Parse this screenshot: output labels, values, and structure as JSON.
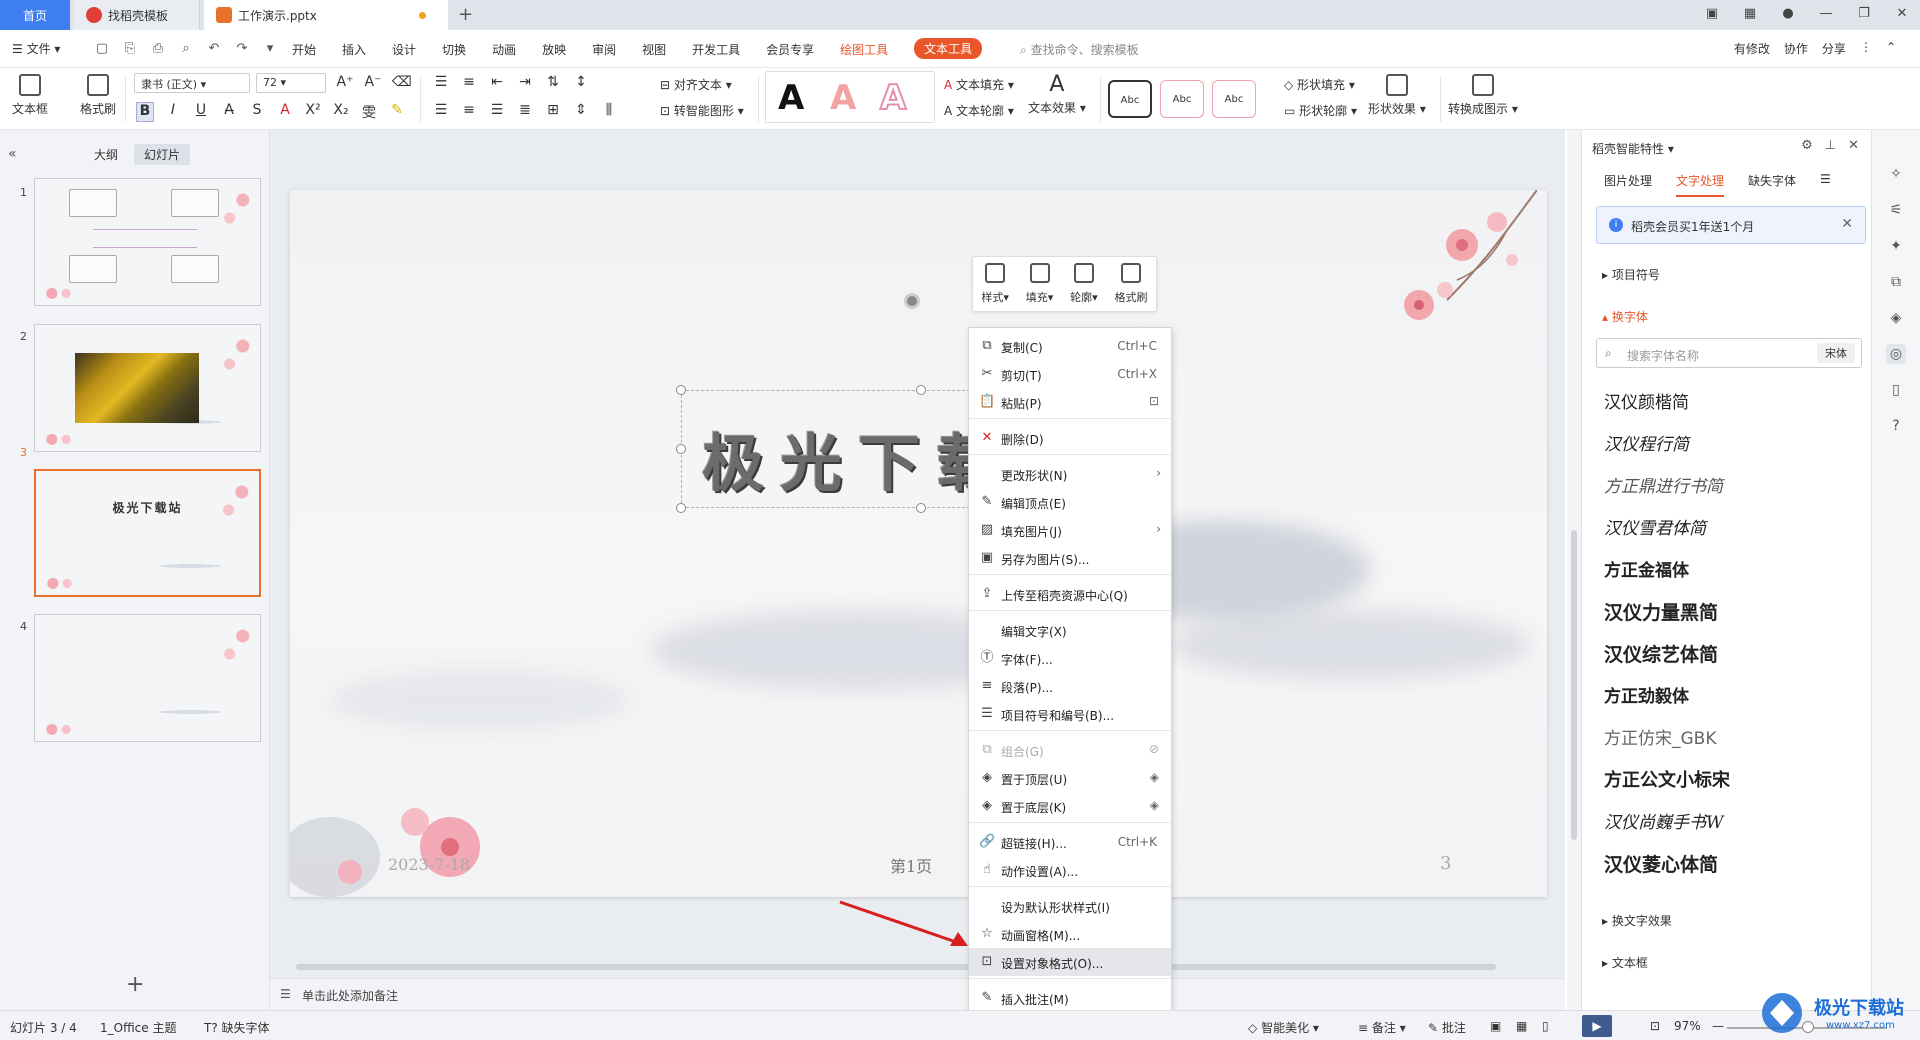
{
  "titlebar": {
    "tabs": [
      {
        "label": "首页"
      },
      {
        "label": "找稻壳模板"
      },
      {
        "label": "工作演示.pptx"
      }
    ]
  },
  "menubar": {
    "file_label": "文件",
    "menus": [
      "开始",
      "插入",
      "设计",
      "切换",
      "动画",
      "放映",
      "审阅",
      "视图",
      "开发工具",
      "会员专享",
      "绘图工具",
      "文本工具"
    ],
    "search_placeholder": "查找命令、搜索模板",
    "right": [
      "有修改",
      "协作",
      "分享"
    ]
  },
  "ribbon": {
    "textbox_label": "文本框",
    "format_painter_label": "格式刷",
    "font_name": "隶书 (正文)",
    "font_size": "72",
    "align_text_label": "对齐文本",
    "smart_shape_label": "转智能图形",
    "text_fill_label": "文本填充",
    "text_outline_label": "文本轮廓",
    "text_effect_label": "文本效果",
    "shape_fill_label": "形状填充",
    "shape_outline_label": "形状轮廓",
    "shape_effect_label": "形状效果",
    "convert_label": "转换成图示",
    "abc_label": "Abc"
  },
  "leftpanel": {
    "tabs": [
      "大纲",
      "幻灯片"
    ],
    "slides": [
      {
        "num": "1"
      },
      {
        "num": "2"
      },
      {
        "num": "3",
        "title": "极光下载站"
      },
      {
        "num": "4"
      }
    ]
  },
  "slide": {
    "title": "极光下载站",
    "date": "2023-7-18",
    "page_label": "第1页",
    "number": "3"
  },
  "minitoolbar": [
    "样式",
    "填充",
    "轮廓",
    "格式刷"
  ],
  "contextmenu": {
    "items": [
      {
        "label": "复制(C)",
        "shortcut": "Ctrl+C"
      },
      {
        "label": "剪切(T)",
        "shortcut": "Ctrl+X"
      },
      {
        "label": "粘贴(P)"
      },
      {
        "label": "删除(D)"
      },
      {
        "label": "更改形状(N)"
      },
      {
        "label": "编辑顶点(E)"
      },
      {
        "label": "填充图片(J)"
      },
      {
        "label": "另存为图片(S)..."
      },
      {
        "label": "上传至稻壳资源中心(Q)"
      },
      {
        "label": "编辑文字(X)"
      },
      {
        "label": "字体(F)..."
      },
      {
        "label": "段落(P)..."
      },
      {
        "label": "项目符号和编号(B)..."
      },
      {
        "label": "组合(G)"
      },
      {
        "label": "置于顶层(U)"
      },
      {
        "label": "置于底层(K)"
      },
      {
        "label": "超链接(H)...",
        "shortcut": "Ctrl+K"
      },
      {
        "label": "动作设置(A)..."
      },
      {
        "label": "设为默认形状样式(I)"
      },
      {
        "label": "动画窗格(M)..."
      },
      {
        "label": "设置对象格式(O)..."
      },
      {
        "label": "插入批注(M)"
      }
    ]
  },
  "notes": {
    "placeholder": "单击此处添加备注"
  },
  "rightpanel": {
    "title": "稻壳智能特性",
    "tabs": [
      "图片处理",
      "文字处理",
      "缺失字体"
    ],
    "banner": "稻壳会员买1年送1个月",
    "sections": [
      "项目符号",
      "换字体",
      "换文字效果",
      "文本框"
    ],
    "search_placeholder": "搜索字体名称",
    "search_value": "宋体",
    "fonts": [
      "汉仪颜楷简",
      "汉仪程行简",
      "方正鼎进行书简",
      "汉仪雪君体简",
      "方正金福体",
      "汉仪力量黑简",
      "汉仪综艺体简",
      "方正劲毅体",
      "方正仿宋_GBK",
      "方正公文小标宋",
      "汉仪尚巍手书W",
      "汉仪菱心体简"
    ]
  },
  "statusbar": {
    "slide_info": "幻灯片 3 / 4",
    "theme": "1_Office 主题",
    "missing_font": "缺失字体",
    "smart_beautify": "智能美化",
    "notes": "备注",
    "comments": "批注",
    "zoom": "97%"
  },
  "watermark": {
    "text": "极光下载站",
    "url": "www.xz7.com"
  }
}
